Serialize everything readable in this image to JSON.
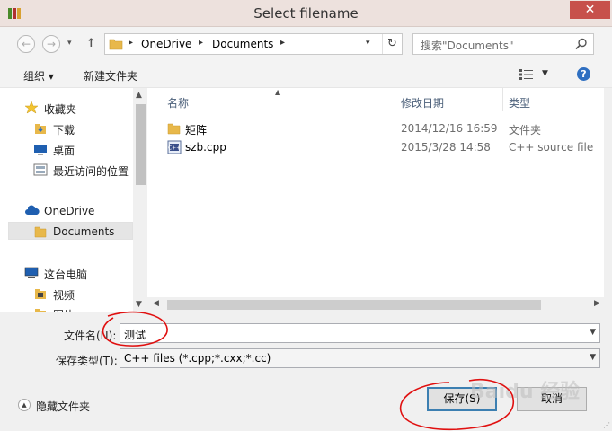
{
  "window": {
    "title": "Select filename",
    "close_glyph": "✕"
  },
  "nav": {
    "back_glyph": "←",
    "forward_glyph": "→",
    "up_glyph": "↑",
    "breadcrumb": [
      "OneDrive",
      "Documents"
    ],
    "refresh_glyph": "↻",
    "search_placeholder": "搜索\"Documents\""
  },
  "toolbar": {
    "organize": "组织 ▾",
    "new_folder": "新建文件夹",
    "help": "?"
  },
  "sidebar": {
    "items": [
      {
        "label": "收藏夹",
        "icon": "star-icon"
      },
      {
        "label": "下载",
        "icon": "download-folder-icon"
      },
      {
        "label": "桌面",
        "icon": "desktop-icon"
      },
      {
        "label": "最近访问的位置",
        "icon": "recent-places-icon"
      },
      {
        "label": "OneDrive",
        "icon": "cloud-icon"
      },
      {
        "label": "Documents",
        "icon": "folder-icon"
      },
      {
        "label": "这台电脑",
        "icon": "computer-icon"
      },
      {
        "label": "视频",
        "icon": "video-folder-icon"
      },
      {
        "label": "图片",
        "icon": "picture-folder-icon"
      }
    ]
  },
  "columns": {
    "name": "名称",
    "modified": "修改日期",
    "type": "类型"
  },
  "files": [
    {
      "name": "矩阵",
      "modified": "2014/12/16 16:59",
      "type": "文件夹",
      "icon": "folder-icon"
    },
    {
      "name": "szb.cpp",
      "modified": "2015/3/28 14:58",
      "type": "C++ source file",
      "icon": "cpp-file-icon"
    }
  ],
  "form": {
    "filename_label": "文件名(N):",
    "filename_value": "测试",
    "filetype_label": "保存类型(T):",
    "filetype_value": "C++ files (*.cpp;*.cxx;*.cc)"
  },
  "footer": {
    "hide_folders": "隐藏文件夹",
    "save": "保存(S)",
    "cancel": "取消",
    "watermark": "Baidu 经验"
  },
  "colors": {
    "title_bar": "#ede1dd",
    "close_button": "#c7504b",
    "selected_item": "#e5e5e5",
    "annotation": "#e01010"
  }
}
